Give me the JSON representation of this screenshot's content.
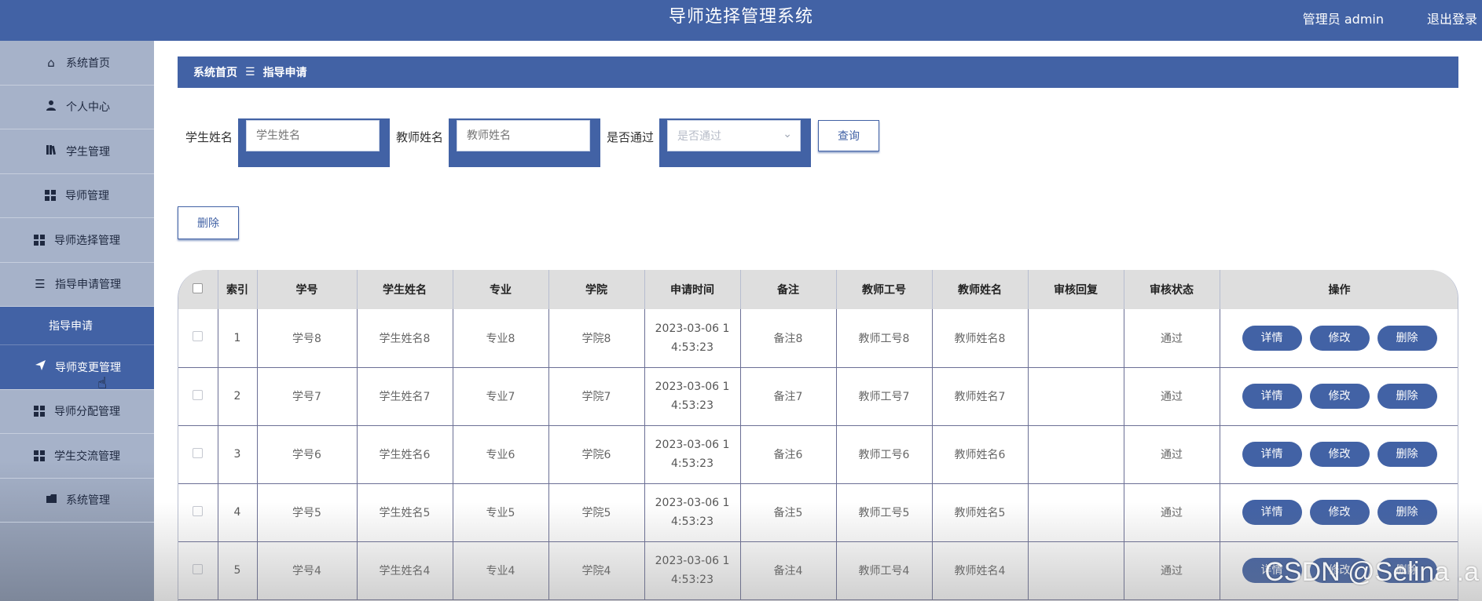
{
  "header": {
    "title": "导师选择管理系统",
    "user": "管理员 admin",
    "logout": "退出登录"
  },
  "sidebar": {
    "items": [
      {
        "label": "系统首页",
        "icon": "home-icon"
      },
      {
        "label": "个人中心",
        "icon": "person-icon"
      },
      {
        "label": "学生管理",
        "icon": "book-icon"
      },
      {
        "label": "导师管理",
        "icon": "grid-icon"
      },
      {
        "label": "导师选择管理",
        "icon": "grid-icon"
      },
      {
        "label": "指导申请管理",
        "icon": "list-icon"
      },
      {
        "label": "指导申请",
        "icon": ""
      },
      {
        "label": "导师变更管理",
        "icon": "send-icon"
      },
      {
        "label": "导师分配管理",
        "icon": "grid-icon"
      },
      {
        "label": "学生交流管理",
        "icon": "grid-icon"
      },
      {
        "label": "系统管理",
        "icon": "folder-icon"
      }
    ]
  },
  "breadcrumb": {
    "home": "系统首页",
    "separator": "☰",
    "current": "指导申请"
  },
  "search": {
    "student_label": "学生姓名",
    "student_placeholder": "学生姓名",
    "teacher_label": "教师姓名",
    "teacher_placeholder": "教师姓名",
    "pass_label": "是否通过",
    "pass_placeholder": "是否通过",
    "query_button": "查询"
  },
  "actions": {
    "delete_button": "删除"
  },
  "table": {
    "headers": [
      "索引",
      "学号",
      "学生姓名",
      "专业",
      "学院",
      "申请时间",
      "备注",
      "教师工号",
      "教师姓名",
      "审核回复",
      "审核状态",
      "操作"
    ],
    "rows": [
      {
        "index": "1",
        "student_no": "学号8",
        "student_name": "学生姓名8",
        "major": "专业8",
        "college": "学院8",
        "time_line1": "2023-03-06 1",
        "time_line2": "4:53:23",
        "note": "备注8",
        "teacher_no": "教师工号8",
        "teacher_name": "教师姓名8",
        "reply": "",
        "status": "通过"
      },
      {
        "index": "2",
        "student_no": "学号7",
        "student_name": "学生姓名7",
        "major": "专业7",
        "college": "学院7",
        "time_line1": "2023-03-06 1",
        "time_line2": "4:53:23",
        "note": "备注7",
        "teacher_no": "教师工号7",
        "teacher_name": "教师姓名7",
        "reply": "",
        "status": "通过"
      },
      {
        "index": "3",
        "student_no": "学号6",
        "student_name": "学生姓名6",
        "major": "专业6",
        "college": "学院6",
        "time_line1": "2023-03-06 1",
        "time_line2": "4:53:23",
        "note": "备注6",
        "teacher_no": "教师工号6",
        "teacher_name": "教师姓名6",
        "reply": "",
        "status": "通过"
      },
      {
        "index": "4",
        "student_no": "学号5",
        "student_name": "学生姓名5",
        "major": "专业5",
        "college": "学院5",
        "time_line1": "2023-03-06 1",
        "time_line2": "4:53:23",
        "note": "备注5",
        "teacher_no": "教师工号5",
        "teacher_name": "教师姓名5",
        "reply": "",
        "status": "通过"
      },
      {
        "index": "5",
        "student_no": "学号4",
        "student_name": "学生姓名4",
        "major": "专业4",
        "college": "学院4",
        "time_line1": "2023-03-06 1",
        "time_line2": "4:53:23",
        "note": "备注4",
        "teacher_no": "教师工号4",
        "teacher_name": "教师姓名4",
        "reply": "",
        "status": "通过"
      }
    ],
    "op_detail": "详情",
    "op_edit": "修改",
    "op_delete": "删除"
  },
  "watermark": "CSDN @Selina .a",
  "colors": {
    "primary": "#4262a5",
    "sidebar_bg": "#a6b2c9",
    "table_header_bg": "#dedede"
  }
}
